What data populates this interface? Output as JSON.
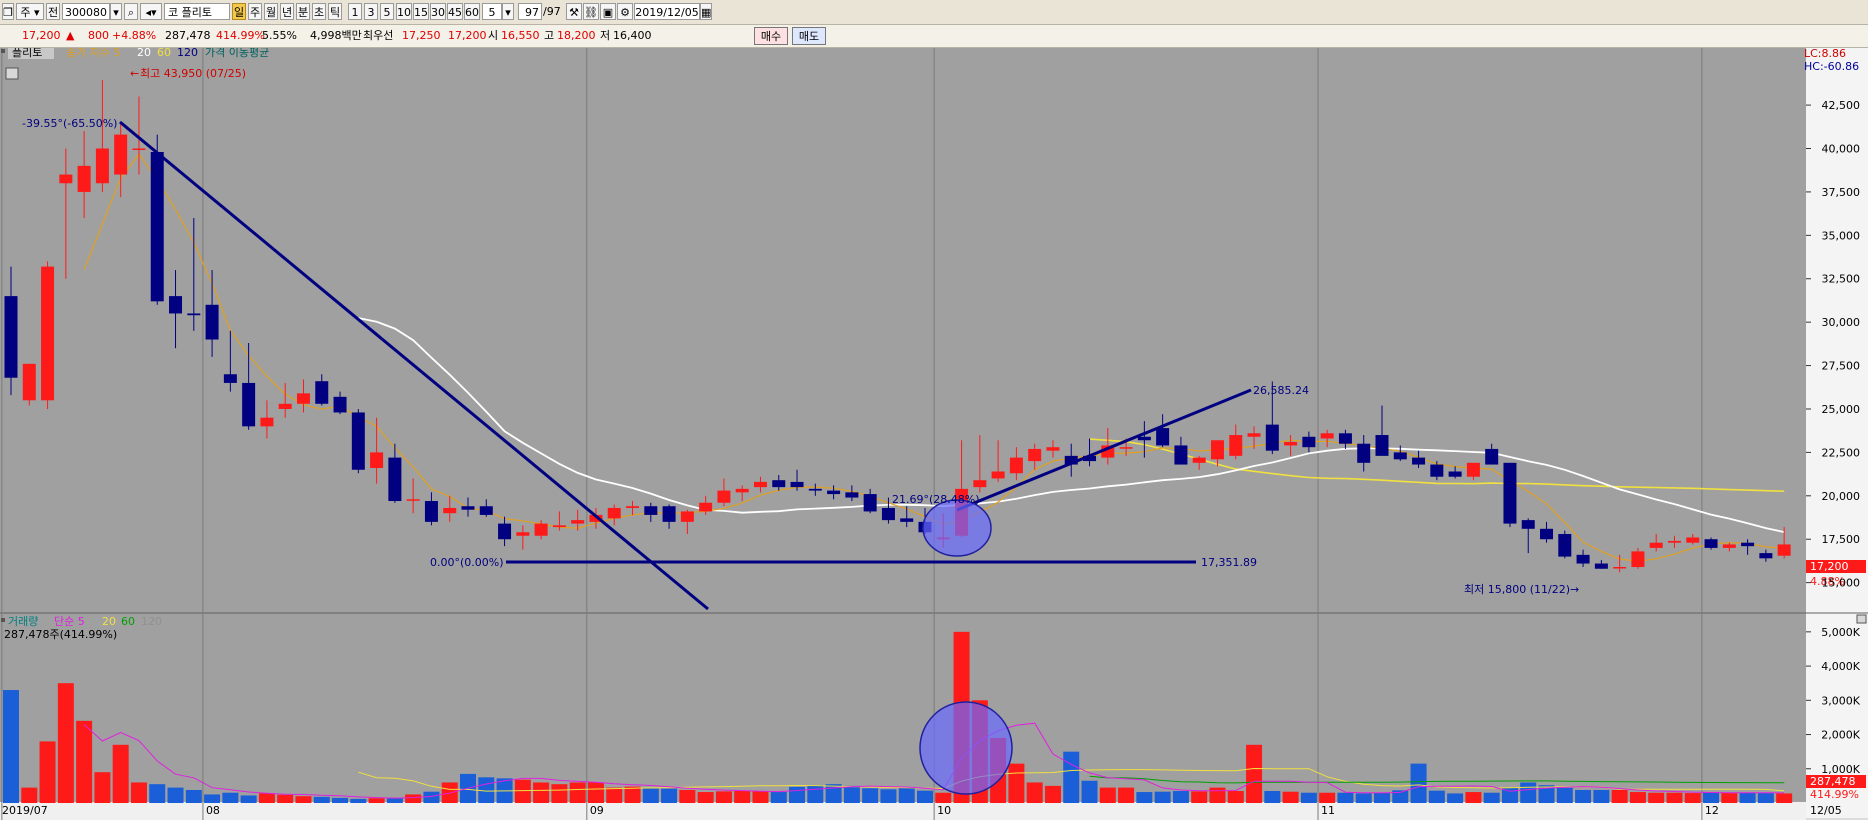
{
  "toolbar": {
    "market_select": "주",
    "period_select": "전",
    "code_input": "300080",
    "stock_name": "플리토",
    "period_tabs": [
      "일",
      "주",
      "월",
      "년",
      "분",
      "초",
      "틱"
    ],
    "selected_period": "일",
    "interval_options": [
      "1",
      "3",
      "5",
      "10",
      "15",
      "30",
      "45",
      "60"
    ],
    "interval_value": "5",
    "count_value": "97",
    "count_total": "/97",
    "date_value": "2019/12/05"
  },
  "quote": {
    "price": "17,200",
    "change_arrow": "▲",
    "change": "800",
    "change_pct": "+4.88%",
    "volume": "287,478",
    "volume_ratio": "414.99%",
    "turnover": "5.55%",
    "amount": "4,998백만",
    "bid_label": "최우선",
    "ask_price": "17,250",
    "bid_price": "17,200",
    "open_label": "시",
    "open": "16,550",
    "high_label": "고",
    "high": "18,200",
    "low_label": "저",
    "low": "16,400",
    "buy_button": "매수",
    "sell_button": "매도"
  },
  "colors": {
    "background": "#a0a0a0",
    "up": "#ff1a1a",
    "down": "#000080",
    "ma5": "#e0a020",
    "ma20": "#ffffff",
    "ma60": "#f0e040",
    "trendline": "#000080",
    "volume_down": "#1a5fd8",
    "volume_up": "#ff1a1a"
  },
  "chart_data": [
    {
      "type": "candlestick",
      "title": "",
      "legend": {
        "name": "플리토",
        "items": [
          "종가 지수 5",
          "20",
          "60",
          "120",
          "가격 이동평균"
        ]
      },
      "ylim": [
        14000,
        45500
      ],
      "y_ticks": [
        "42,500",
        "40,000",
        "37,500",
        "35,000",
        "32,500",
        "30,000",
        "27,500",
        "25,000",
        "22,500",
        "20,000",
        "17,500",
        "15,000"
      ],
      "x_month_labels": [
        "2019/07",
        "08",
        "09",
        "10",
        "11",
        "12",
        "12/05"
      ],
      "x_month_index": [
        0,
        11,
        32,
        51,
        72,
        93
      ],
      "top_right": [
        "LC:8.86",
        "HC:-60.86"
      ],
      "last_price_tag": "17,200",
      "last_pct_tag": "4.88%",
      "annotations": {
        "high": "최고 43,950 (07/25)",
        "low": "최저 15,800 (11/22)",
        "trend_down": "-39.55°(-65.50%)",
        "trend_up": "21.69°(28.48%)",
        "base": "0.00°(0.00%)",
        "base_value": "17,351.89",
        "peak_value": "26,585.24"
      },
      "ohlc": [
        [
          31500,
          33200,
          25800,
          26800
        ],
        [
          25500,
          27500,
          25200,
          27600
        ],
        [
          25500,
          33500,
          25000,
          33200
        ],
        [
          38000,
          40000,
          32500,
          38500
        ],
        [
          37500,
          41000,
          36000,
          39000
        ],
        [
          38000,
          43950,
          37500,
          40000
        ],
        [
          38500,
          41500,
          37200,
          40800
        ],
        [
          40000,
          43000,
          38500,
          40000
        ],
        [
          39800,
          40800,
          31000,
          31200
        ],
        [
          31500,
          33000,
          28500,
          30500
        ],
        [
          30500,
          36000,
          29500,
          30400
        ],
        [
          31000,
          33000,
          28000,
          29000
        ],
        [
          27000,
          29500,
          26000,
          26500
        ],
        [
          26500,
          28800,
          23800,
          24000
        ],
        [
          24000,
          25500,
          23300,
          24500
        ],
        [
          25000,
          26500,
          24500,
          25300
        ],
        [
          25300,
          26700,
          24800,
          25900
        ],
        [
          26600,
          27000,
          25200,
          25300
        ],
        [
          25700,
          26000,
          24700,
          24800
        ],
        [
          24800,
          25000,
          21300,
          21500
        ],
        [
          21600,
          24500,
          20700,
          22500
        ],
        [
          22200,
          23000,
          19600,
          19700
        ],
        [
          19800,
          21000,
          19000,
          19800
        ],
        [
          19700,
          20200,
          18300,
          18500
        ],
        [
          19000,
          20000,
          18500,
          19300
        ],
        [
          19400,
          19900,
          18800,
          19200
        ],
        [
          19400,
          19800,
          18800,
          18900
        ],
        [
          18400,
          18800,
          17100,
          17500
        ],
        [
          17700,
          18300,
          16900,
          17900
        ],
        [
          17700,
          18600,
          17500,
          18400
        ],
        [
          18200,
          19100,
          18000,
          18300
        ],
        [
          18400,
          19200,
          18000,
          18600
        ],
        [
          18500,
          19300,
          18100,
          18900
        ],
        [
          18700,
          19500,
          18300,
          19300
        ],
        [
          19300,
          19700,
          18900,
          19400
        ],
        [
          19400,
          19600,
          18500,
          18900
        ],
        [
          19400,
          19500,
          18100,
          18500
        ],
        [
          18500,
          19200,
          17800,
          19100
        ],
        [
          19100,
          20000,
          18900,
          19600
        ],
        [
          19600,
          21000,
          19400,
          20300
        ],
        [
          20200,
          20600,
          19700,
          20400
        ],
        [
          20500,
          21100,
          20200,
          20800
        ],
        [
          20900,
          21200,
          20300,
          20500
        ],
        [
          20800,
          21500,
          20300,
          20500
        ],
        [
          20400,
          20700,
          20000,
          20300
        ],
        [
          20300,
          20600,
          19800,
          20100
        ],
        [
          20200,
          20600,
          19700,
          19900
        ],
        [
          20100,
          20400,
          19000,
          19100
        ],
        [
          19300,
          19900,
          18400,
          18600
        ],
        [
          18700,
          19400,
          18200,
          18500
        ],
        [
          18500,
          19300,
          17800,
          17900
        ],
        [
          17500,
          19000,
          17000,
          17600
        ],
        [
          17700,
          23200,
          17600,
          20400
        ],
        [
          20500,
          23500,
          20200,
          20900
        ],
        [
          21000,
          23200,
          20800,
          21400
        ],
        [
          21300,
          22800,
          20900,
          22200
        ],
        [
          22000,
          23000,
          21500,
          22700
        ],
        [
          22600,
          23200,
          22200,
          22800
        ],
        [
          22300,
          23000,
          21100,
          21800
        ],
        [
          22300,
          23300,
          21700,
          22000
        ],
        [
          22200,
          23900,
          21800,
          22900
        ],
        [
          22800,
          23300,
          22300,
          22800
        ],
        [
          23400,
          24300,
          22200,
          23200
        ],
        [
          23900,
          24700,
          22800,
          22900
        ],
        [
          22900,
          23400,
          21800,
          21800
        ],
        [
          21900,
          22300,
          21500,
          22200
        ],
        [
          22100,
          23000,
          21700,
          23200
        ],
        [
          22300,
          24100,
          22100,
          23500
        ],
        [
          23400,
          24000,
          22700,
          23600
        ],
        [
          24100,
          26585,
          22400,
          22600
        ],
        [
          22900,
          23500,
          22300,
          23100
        ],
        [
          23400,
          23700,
          22500,
          22800
        ],
        [
          23300,
          23800,
          22800,
          23600
        ],
        [
          23600,
          23800,
          22700,
          23000
        ],
        [
          23000,
          23500,
          21400,
          21900
        ],
        [
          23500,
          25200,
          22400,
          22300
        ],
        [
          22500,
          22900,
          22000,
          22100
        ],
        [
          22200,
          22600,
          21600,
          21800
        ],
        [
          21800,
          22000,
          20900,
          21100
        ],
        [
          21400,
          21700,
          21000,
          21100
        ],
        [
          21100,
          21800,
          20900,
          21900
        ],
        [
          22700,
          23000,
          21800,
          21800
        ],
        [
          21900,
          21900,
          18200,
          18400
        ],
        [
          18600,
          18700,
          16700,
          18100
        ],
        [
          18100,
          18500,
          17300,
          17500
        ],
        [
          17800,
          18000,
          16400,
          16500
        ],
        [
          16600,
          16900,
          15900,
          16100
        ],
        [
          16100,
          16300,
          15800,
          15800
        ],
        [
          15900,
          16600,
          15600,
          15900
        ],
        [
          15900,
          17000,
          15800,
          16800
        ],
        [
          17000,
          17800,
          16800,
          17300
        ],
        [
          17300,
          17700,
          17000,
          17400
        ],
        [
          17300,
          17800,
          17200,
          17600
        ],
        [
          17500,
          17600,
          16900,
          17000
        ],
        [
          17000,
          17300,
          16800,
          17200
        ],
        [
          17300,
          17500,
          16600,
          17100
        ],
        [
          16700,
          16900,
          16200,
          16400
        ],
        [
          16550,
          18200,
          16400,
          17200
        ]
      ]
    },
    {
      "type": "bar",
      "title": "",
      "legend": {
        "name": "거래량",
        "items": [
          "단순 5",
          "20",
          "60",
          "120"
        ]
      },
      "volume_readout": "287,478주(414.99%)",
      "y_ticks": [
        "5,000K",
        "4,000K",
        "3,000K",
        "2,000K",
        "1,000K"
      ],
      "ylim_k": [
        0,
        5200
      ],
      "last_volume_tag": "287,478",
      "last_ratio_tag": "414.99%",
      "values_k": [
        3300,
        450,
        1800,
        3500,
        2400,
        900,
        1700,
        600,
        550,
        450,
        380,
        250,
        300,
        220,
        280,
        240,
        200,
        180,
        150,
        120,
        140,
        130,
        250,
        330,
        600,
        850,
        750,
        720,
        680,
        600,
        550,
        600,
        600,
        450,
        480,
        420,
        420,
        380,
        320,
        340,
        350,
        340,
        320,
        470,
        520,
        550,
        500,
        430,
        400,
        450,
        360,
        300,
        5000,
        3000,
        1900,
        1150,
        600,
        500,
        1500,
        650,
        450,
        450,
        320,
        330,
        350,
        340,
        450,
        350,
        1700,
        350,
        330,
        300,
        300,
        300,
        280,
        300,
        370,
        1150,
        360,
        280,
        320,
        300,
        450,
        600,
        520,
        440,
        380,
        380,
        380,
        320,
        300,
        300,
        290,
        320,
        290,
        300,
        290,
        280
      ]
    }
  ]
}
